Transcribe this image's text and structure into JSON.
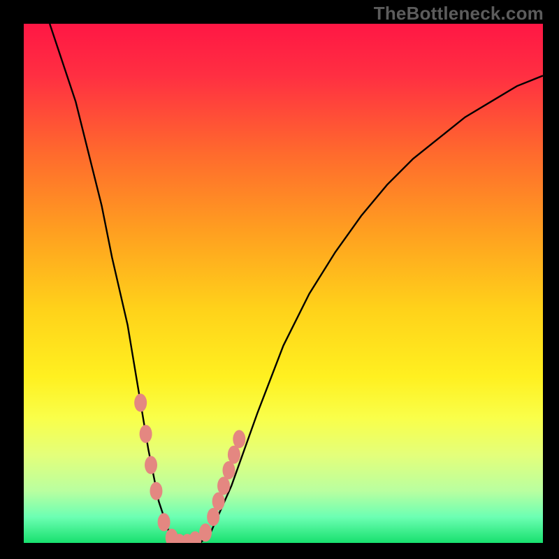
{
  "watermark": {
    "text": "TheBottleneck.com"
  },
  "chart_data": {
    "type": "line",
    "title": "",
    "xlabel": "",
    "ylabel": "",
    "xlim": [
      0,
      100
    ],
    "ylim": [
      0,
      100
    ],
    "grid": false,
    "x": [
      0,
      5,
      10,
      15,
      17,
      20,
      22,
      24,
      26,
      28,
      30,
      32,
      34,
      36,
      40,
      45,
      50,
      55,
      60,
      65,
      70,
      75,
      80,
      85,
      90,
      95,
      100
    ],
    "series": [
      {
        "name": "curve",
        "color": "#000000",
        "values": [
          null,
          100,
          85,
          65,
          55,
          42,
          30,
          18,
          8,
          2,
          0,
          0,
          0,
          2,
          11,
          25,
          38,
          48,
          56,
          63,
          69,
          74,
          78,
          82,
          85,
          88,
          90
        ]
      }
    ],
    "highlights": {
      "description": "Pink bead marks along the curve near the trough region (left descent and right ascent between x≈22 and x≈41).",
      "points": [
        {
          "x": 22.5,
          "y": 27
        },
        {
          "x": 23.5,
          "y": 21
        },
        {
          "x": 24.5,
          "y": 15
        },
        {
          "x": 25.5,
          "y": 10
        },
        {
          "x": 27.0,
          "y": 4
        },
        {
          "x": 28.5,
          "y": 1
        },
        {
          "x": 30.0,
          "y": 0
        },
        {
          "x": 31.5,
          "y": 0
        },
        {
          "x": 33.0,
          "y": 0.5
        },
        {
          "x": 35.0,
          "y": 2
        },
        {
          "x": 36.5,
          "y": 5
        },
        {
          "x": 37.5,
          "y": 8
        },
        {
          "x": 38.5,
          "y": 11
        },
        {
          "x": 39.5,
          "y": 14
        },
        {
          "x": 40.5,
          "y": 17
        },
        {
          "x": 41.5,
          "y": 20
        }
      ],
      "color": "#e48781"
    },
    "background_gradient": {
      "type": "vertical",
      "stops": [
        {
          "pos": 0.0,
          "color": "#ff1744"
        },
        {
          "pos": 0.1,
          "color": "#ff2f42"
        },
        {
          "pos": 0.25,
          "color": "#ff6a2d"
        },
        {
          "pos": 0.4,
          "color": "#ff9f20"
        },
        {
          "pos": 0.55,
          "color": "#ffd21a"
        },
        {
          "pos": 0.68,
          "color": "#fff020"
        },
        {
          "pos": 0.76,
          "color": "#f9ff4a"
        },
        {
          "pos": 0.83,
          "color": "#e4ff7a"
        },
        {
          "pos": 0.9,
          "color": "#b9ffa0"
        },
        {
          "pos": 0.95,
          "color": "#6cffb3"
        },
        {
          "pos": 1.0,
          "color": "#18e06e"
        }
      ]
    }
  }
}
